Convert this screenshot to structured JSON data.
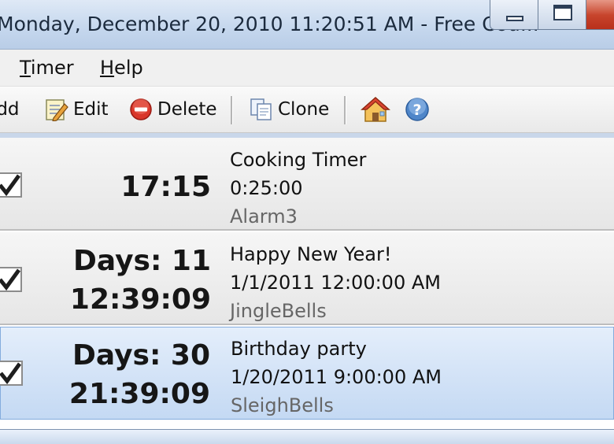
{
  "window": {
    "title": "Monday, December 20, 2010 11:20:51 AM - Free Cou..."
  },
  "menu": {
    "items": [
      {
        "pre": "",
        "ul": "T",
        "post": "imer"
      },
      {
        "pre": "",
        "ul": "H",
        "post": "elp"
      }
    ]
  },
  "toolbar": {
    "add_label": "Add",
    "edit_label": "Edit",
    "delete_label": "Delete",
    "clone_label": "Clone"
  },
  "timers": [
    {
      "checked": true,
      "line1": "17:15",
      "line2": "",
      "name": "Cooking Timer",
      "target": "0:25:00",
      "sound": "Alarm3",
      "selected": false
    },
    {
      "checked": true,
      "line1": "Days: 11",
      "line2": "12:39:09",
      "name": "Happy New Year!",
      "target": "1/1/2011 12:00:00 AM",
      "sound": "JingleBells",
      "selected": false
    },
    {
      "checked": true,
      "line1": "Days: 30",
      "line2": "21:39:09",
      "name": "Birthday party",
      "target": "1/20/2011 9:00:00 AM",
      "sound": "SleighBells",
      "selected": true
    }
  ],
  "colors": {
    "selection": "#c4d9f3",
    "delete_red": "#d9372b",
    "help_blue": "#4f86c9"
  }
}
